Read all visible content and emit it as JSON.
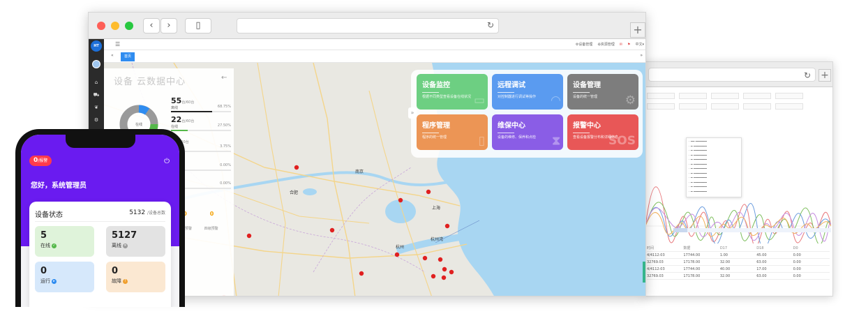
{
  "map": {
    "cities": [
      {
        "name": "合肥"
      },
      {
        "name": "南京"
      },
      {
        "name": "上海"
      },
      {
        "name": "杭州"
      },
      {
        "name": "杭州湾"
      }
    ]
  },
  "browser_main": {
    "appbar": {
      "device_mgmt": "⚙设备管理",
      "resource_mgmt": "♻资源管理",
      "lang": "中文▾"
    },
    "tab_home": "首页"
  },
  "data_panel": {
    "title": "设备 云数据中心",
    "rows": [
      {
        "count": "55",
        "unit": "台/60台",
        "label": "离线",
        "pct": "68.75%",
        "fill": 0.6875,
        "color": "#222222"
      },
      {
        "count": "22",
        "unit": "台/60台",
        "label": "在线",
        "pct": "27.50%",
        "fill": 0.275,
        "color": "#55b84a"
      },
      {
        "count": "3",
        "unit": "台/60台",
        "label": "运行",
        "pct": "3.75%",
        "fill": 0.0375,
        "color": "#2f8cf0"
      },
      {
        "count": "",
        "unit": "",
        "label": "",
        "pct": "0.00%",
        "fill": 0,
        "color": "#f4a000"
      },
      {
        "count": "",
        "unit": "",
        "label": "",
        "pct": "0.00%",
        "fill": 0,
        "color": "#f4a000"
      }
    ],
    "donut_label": "在线",
    "alarm_values": [
      "0",
      "0"
    ],
    "alarm_labels": [
      "三级预警",
      "四级预警"
    ]
  },
  "cards": [
    {
      "title": "设备监控",
      "desc": "根据不同类型查看设备在线状况",
      "color": "#6dcf82",
      "deco": "▭"
    },
    {
      "title": "远程调试",
      "desc": "对控制器进行调试等操作",
      "color": "#5a9bf0",
      "deco": "◠"
    },
    {
      "title": "设备管理",
      "desc": "设备的统一管理",
      "color": "#7d7d7d",
      "deco": "⚙"
    },
    {
      "title": "程序管理",
      "desc": "程序的统一管理",
      "color": "#ec9555",
      "deco": "▯"
    },
    {
      "title": "维保中心",
      "desc": "设备的维修、保养和点检",
      "color": "#8a5de6",
      "deco": "⧗"
    },
    {
      "title": "报警中心",
      "desc": "查看设备报警分布和详细信息",
      "color": "#e85757",
      "deco": "SOS"
    }
  ],
  "phone": {
    "alarm_count": "0",
    "alarm_unit": "/报警",
    "greeting": "您好，系统管理员",
    "status_title": "设备状态",
    "total": "5132",
    "total_unit": "/设备总数",
    "stats": [
      {
        "value": "5",
        "label": "在线",
        "bg": "#dff3da",
        "badge": "#55b84a",
        "glyph": "✓"
      },
      {
        "value": "5127",
        "label": "离线",
        "bg": "#e3e3e3",
        "badge": "#9a9a9a",
        "glyph": "✕"
      },
      {
        "value": "0",
        "label": "运行",
        "bg": "#d6e8fb",
        "badge": "#2f8cf0",
        "glyph": "▸"
      },
      {
        "value": "0",
        "label": "故障",
        "bg": "#fbe8d2",
        "badge": "#f0a030",
        "glyph": "!"
      }
    ]
  },
  "chart_window": {
    "table_header": [
      "时间",
      "数据",
      "D17",
      "D18",
      "D0"
    ],
    "table_rows": [
      [
        "4/4112:03",
        "17744.00",
        "1.00",
        "45.00",
        "0.00"
      ],
      [
        "32769.03",
        "17178.00",
        "32.00",
        "63.00",
        "0.00"
      ],
      [
        "4/4112:03",
        "17744.00",
        "40.00",
        "17.00",
        "0.00"
      ],
      [
        "32769.03",
        "17178.00",
        "32.00",
        "63.00",
        "0.00"
      ]
    ]
  }
}
